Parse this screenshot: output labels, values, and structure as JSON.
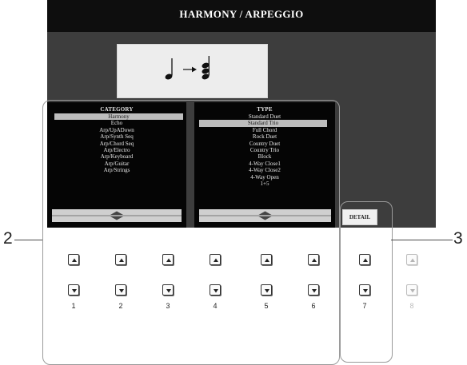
{
  "title": "HARMONY / ARPEGGIO",
  "category": {
    "header": "CATEGORY",
    "items": [
      "Harmony",
      "Echo",
      "Arp/UpADown",
      "Arp/Synth Seq",
      "Arp/Chord Seq",
      "Arp/Electro",
      "Arp/Keyboard",
      "Arp/Guitar",
      "Arp/Strings"
    ],
    "selected_index": 0,
    "scroll_icon": "up-down-arrows-icon"
  },
  "type": {
    "header": "TYPE",
    "items": [
      "Standard Duet",
      "Standard Trio",
      "Full Chord",
      "Rock Duet",
      "Country Duet",
      "Country Trio",
      "Block",
      "4-Way Close1",
      "4-Way Close2",
      "4-Way Open",
      "1+5"
    ],
    "selected_index": 1,
    "scroll_icon": "up-down-arrows-icon"
  },
  "detail_label": "DETAIL",
  "callouts": {
    "left": "2",
    "right": "3"
  },
  "button_columns": [
    "1",
    "2",
    "3",
    "4",
    "5",
    "6",
    "7",
    "8"
  ],
  "illustration": "quarter-note-to-chord-icon",
  "colors": {
    "screen": "#3d3d3d",
    "title_bar": "#0e0e0e",
    "panel": "#050505",
    "highlight": "#bdbdbd"
  }
}
